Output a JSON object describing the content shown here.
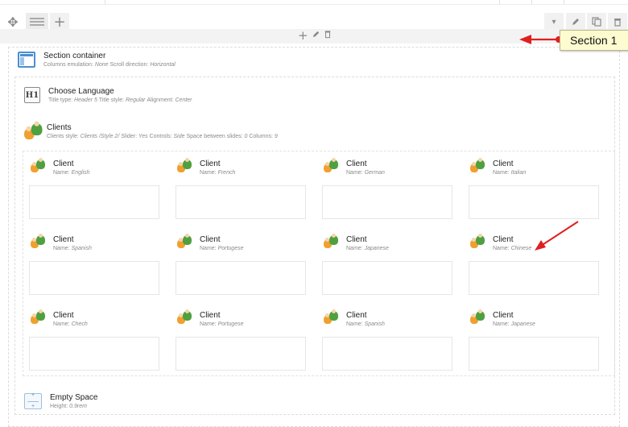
{
  "toolbar": {
    "drag_icon": "move-icon",
    "layout_icon": "layout-bars-icon",
    "add_label": "+",
    "mid_add": "+",
    "mid_edit": "✎",
    "mid_delete": "🗑",
    "right_dropdown": "▾",
    "right_edit": "✎",
    "right_clone": "⧉",
    "right_delete": "🗑"
  },
  "callout": {
    "label": "Section 1"
  },
  "section": {
    "title": "Section container",
    "meta": [
      {
        "key": "Columns emulation:",
        "value": "None"
      },
      {
        "key": "Scroll direction:",
        "value": "Horizontal"
      }
    ]
  },
  "language": {
    "icon_text": "H1",
    "title": "Choose Language",
    "meta": [
      {
        "key": "Title type:",
        "value": "Header 5"
      },
      {
        "key": "Title style:",
        "value": "Regular"
      },
      {
        "key": "Alignment:",
        "value": "Center"
      }
    ]
  },
  "clients": {
    "title": "Clients",
    "meta": [
      {
        "key": "Clients style:",
        "value": "Clients /Style 2/"
      },
      {
        "key": "Slider:",
        "value": "Yes"
      },
      {
        "key": "Controls:",
        "value": "Side"
      },
      {
        "key": "Space between slides:",
        "value": "0"
      },
      {
        "key": "Columns:",
        "value": "9"
      }
    ],
    "item_title": "Client",
    "name_key": "Name:",
    "items": [
      {
        "name": "English"
      },
      {
        "name": "French"
      },
      {
        "name": "German"
      },
      {
        "name": "Italian"
      },
      {
        "name": "Spanish"
      },
      {
        "name": "Portugese"
      },
      {
        "name": "Japanese"
      },
      {
        "name": "Chinese"
      },
      {
        "name": "Chech"
      },
      {
        "name": "Portugese"
      },
      {
        "name": "Spanish"
      },
      {
        "name": "Japanese"
      }
    ]
  },
  "empty_space": {
    "title": "Empty Space",
    "meta": [
      {
        "key": "Height:",
        "value": "0.9rem"
      }
    ]
  },
  "colors": {
    "accent_blue": "#4b8fd1",
    "arrow_red": "#e02020",
    "callout_bg": "#fdfbd0"
  }
}
